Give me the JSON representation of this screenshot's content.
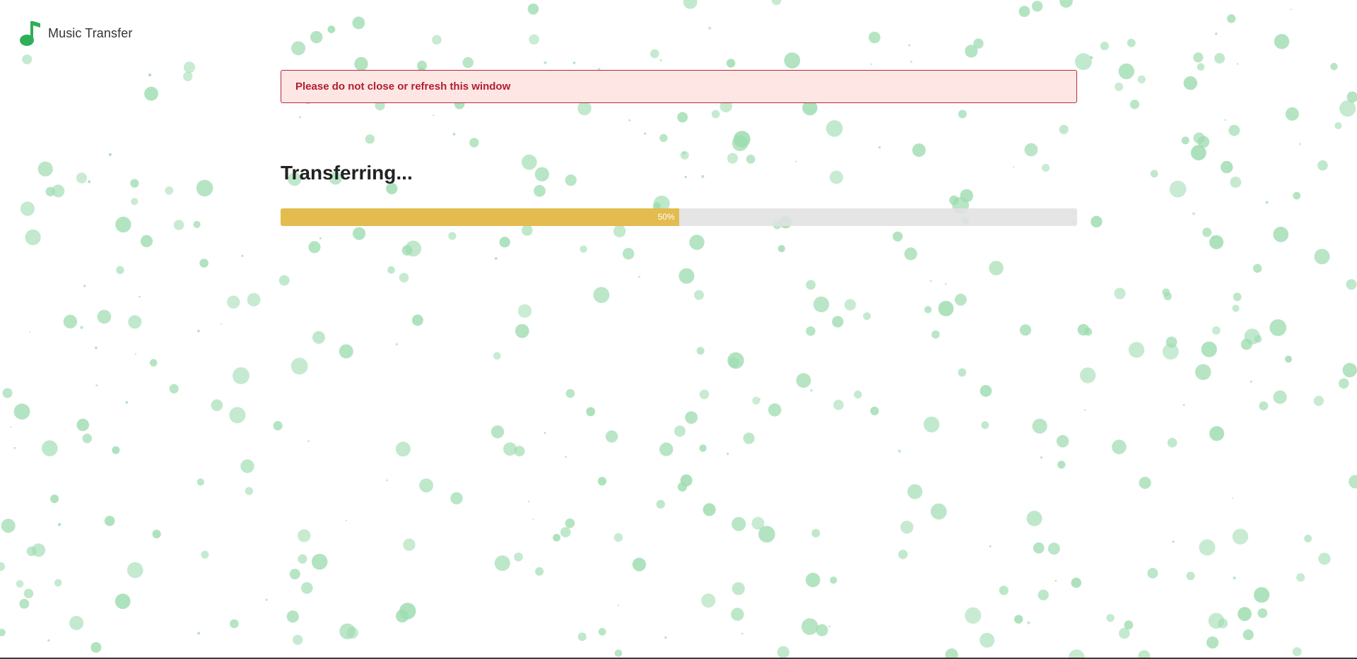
{
  "app": {
    "title": "Music Transfer",
    "logo_icon": "music-note-icon",
    "accent_color": "#2eaf5a"
  },
  "alert": {
    "message": "Please do not close or refresh this window",
    "text_color": "#b01e2e",
    "background": "#fde6e4"
  },
  "transfer": {
    "heading": "Transferring...",
    "progress_label": "50%",
    "progress_fraction": 0.5,
    "bar_color": "#e3bb4f"
  },
  "background": {
    "decoration": "green-bubbles",
    "bubble_color": "#9edcb0"
  }
}
